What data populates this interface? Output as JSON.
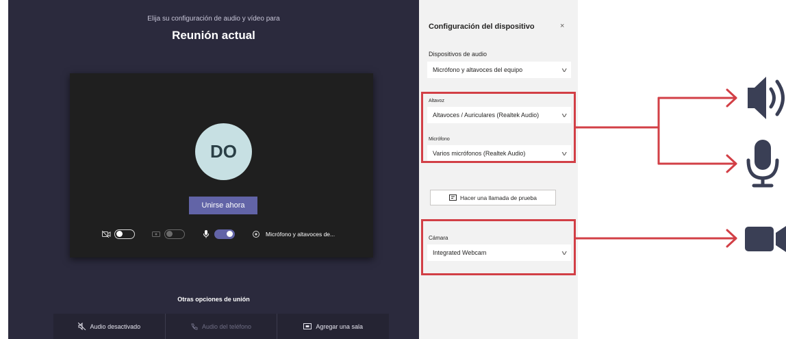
{
  "prejoin": {
    "subtitle": "Elija su configuración de audio y vídeo para",
    "title": "Reunión actual",
    "avatar_initials": "DO",
    "join_label": "Unirse ahora",
    "device_label": "Micrófono y altavoces de...",
    "camera_toggle": "off",
    "effects_toggle": "off",
    "mic_toggle": "on",
    "other_options_title": "Otras opciones de unión",
    "other_options": [
      {
        "label": "Audio desactivado",
        "icon": "speaker-off-icon",
        "enabled": true
      },
      {
        "label": "Audio del teléfono",
        "icon": "phone-icon",
        "enabled": false
      },
      {
        "label": "Agregar una sala",
        "icon": "room-icon",
        "enabled": true
      }
    ]
  },
  "settings": {
    "title": "Configuración del dispositivo",
    "close": "×",
    "audio_devices_label": "Dispositivos de audio",
    "audio_devices_value": "Micrófono y altavoces del equipo",
    "speakers_label": "Altavoz",
    "speakers_value": "Altavoces / Auriculares (Realtek Audio)",
    "microphone_label": "Micrófono",
    "microphone_value": "Varios micrófonos (Realtek Audio)",
    "test_call_label": "Hacer una llamada de prueba",
    "camera_label": "Cámara",
    "camera_value": "Integrated Webcam"
  },
  "annotations": {
    "highlight_color": "#d23f46",
    "icon_color": "#3a3f55",
    "icons": [
      "speaker-icon",
      "microphone-icon",
      "camera-icon"
    ]
  }
}
